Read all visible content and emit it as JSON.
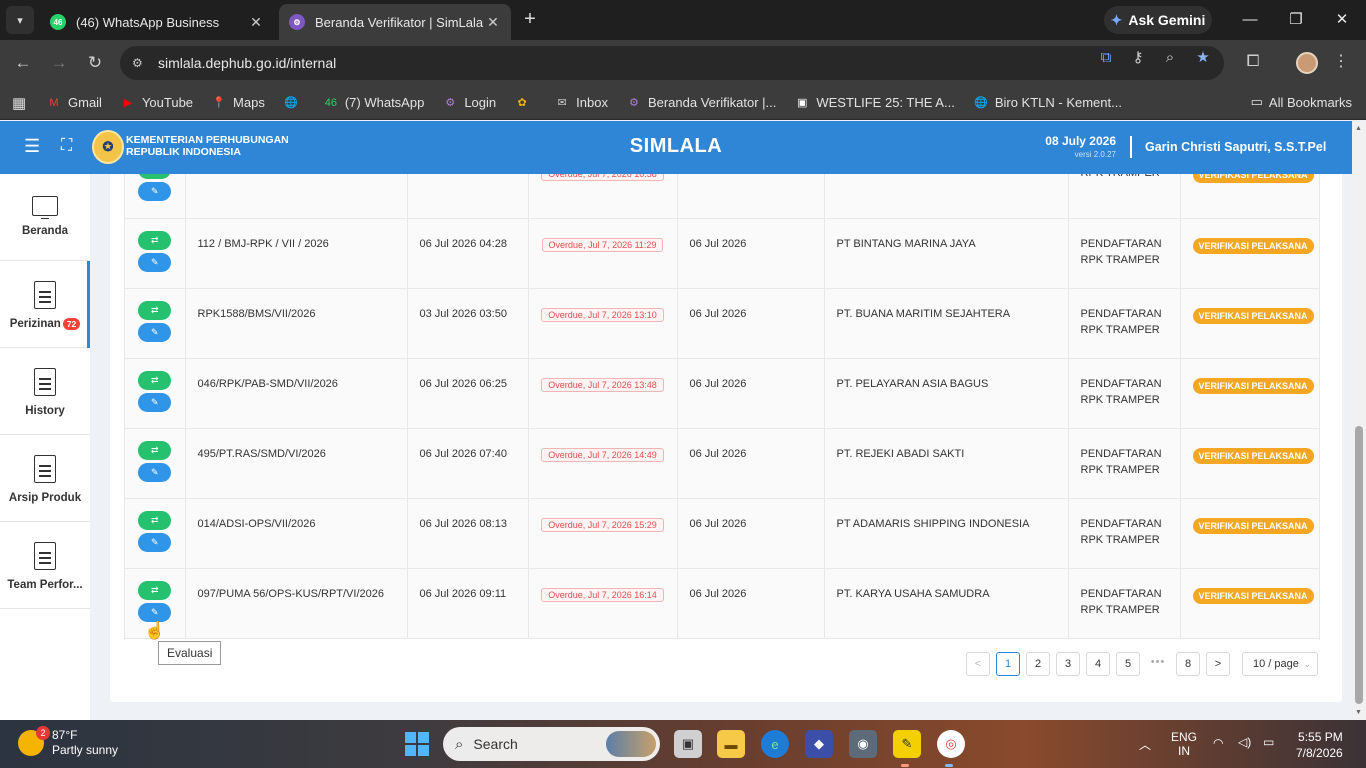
{
  "browser": {
    "tabs": [
      {
        "title": "(46) WhatsApp Business",
        "favicon": "46",
        "active": false
      },
      {
        "title": "Beranda Verifikator | SimLala",
        "favicon": "globe",
        "active": true
      }
    ],
    "gemini_label": "Ask Gemini",
    "url": "simlala.dephub.go.id/internal",
    "bookmarks": [
      {
        "label": "Gmail",
        "icon": "M",
        "color": "#ea4335"
      },
      {
        "label": "YouTube",
        "icon": "▶",
        "color": "#ff0000"
      },
      {
        "label": "Maps",
        "icon": "📍",
        "color": "#34a853"
      },
      {
        "label": "",
        "icon": "🌐",
        "color": "#cccccc"
      },
      {
        "label": "(7) WhatsApp",
        "icon": "46",
        "color": "#25d366"
      },
      {
        "label": "Login",
        "icon": "⚙",
        "color": "#b07dd8"
      },
      {
        "label": "",
        "icon": "✿",
        "color": "#f4b400"
      },
      {
        "label": "Inbox",
        "icon": "✉",
        "color": "#cccccc"
      },
      {
        "label": "Beranda Verifikator |...",
        "icon": "⚙",
        "color": "#b07dd8"
      },
      {
        "label": "WESTLIFE 25: THE A...",
        "icon": "▣",
        "color": "#ffffff"
      },
      {
        "label": "Biro KTLN - Kement...",
        "icon": "🌐",
        "color": "#cccccc"
      }
    ],
    "all_bookmarks": "All Bookmarks"
  },
  "header": {
    "ministry_line1": "KEMENTERIAN PERHUBUNGAN",
    "ministry_line2": "REPUBLIK INDONESIA",
    "app_title": "SIMLALA",
    "date": "08 July 2026",
    "version": "versi 2.0.27",
    "user": "Garin Christi Saputri, S.S.T.Pel"
  },
  "sidebar": {
    "items": [
      {
        "label": "Beranda",
        "icon": "monitor-icon"
      },
      {
        "label": "Perizinan",
        "icon": "document-icon",
        "badge": "72",
        "active": true
      },
      {
        "label": "History",
        "icon": "document-icon"
      },
      {
        "label": "Arsip Produk",
        "icon": "document-icon"
      },
      {
        "label": "Team Perfor...",
        "icon": "document-icon"
      }
    ]
  },
  "table": {
    "rows": [
      {
        "nomor": "",
        "tanggal": "",
        "due": "Overdue, Jul 7, 2026 10:58",
        "tgl": "",
        "perusahaan": "",
        "layanan": [
          "",
          "RPK TRAMPER"
        ],
        "status": "VERIFIKASI PELAKSANA"
      },
      {
        "nomor": "112 / BMJ-RPK / VII / 2026",
        "tanggal": "06 Jul 2026 04:28",
        "due": "Overdue, Jul 7, 2026 11:29",
        "tgl": "06 Jul 2026",
        "perusahaan": "PT BINTANG MARINA JAYA",
        "layanan": [
          "PENDAFTARAN",
          "RPK TRAMPER"
        ],
        "status": "VERIFIKASI PELAKSANA"
      },
      {
        "nomor": "RPK1588/BMS/VII/2026",
        "tanggal": "03 Jul 2026 03:50",
        "due": "Overdue, Jul 7, 2026 13:10",
        "tgl": "06 Jul 2026",
        "perusahaan": "PT. BUANA MARITIM SEJAHTERA",
        "layanan": [
          "PENDAFTARAN",
          "RPK TRAMPER"
        ],
        "status": "VERIFIKASI PELAKSANA"
      },
      {
        "nomor": "046/RPK/PAB-SMD/VII/2026",
        "tanggal": "06 Jul 2026 06:25",
        "due": "Overdue, Jul 7, 2026 13:48",
        "tgl": "06 Jul 2026",
        "perusahaan": "PT. PELAYARAN ASIA BAGUS",
        "layanan": [
          "PENDAFTARAN",
          "RPK TRAMPER"
        ],
        "status": "VERIFIKASI PELAKSANA"
      },
      {
        "nomor": "495/PT.RAS/SMD/VI/2026",
        "tanggal": "06 Jul 2026 07:40",
        "due": "Overdue, Jul 7, 2026 14:49",
        "tgl": "06 Jul 2026",
        "perusahaan": "PT. REJEKI ABADI SAKTI",
        "layanan": [
          "PENDAFTARAN",
          "RPK TRAMPER"
        ],
        "status": "VERIFIKASI PELAKSANA"
      },
      {
        "nomor": "014/ADSI-OPS/VII/2026",
        "tanggal": "06 Jul 2026 08:13",
        "due": "Overdue, Jul 7, 2026 15:29",
        "tgl": "06 Jul 2026",
        "perusahaan": "PT ADAMARIS SHIPPING INDONESIA",
        "layanan": [
          "PENDAFTARAN",
          "RPK TRAMPER"
        ],
        "status": "VERIFIKASI PELAKSANA"
      },
      {
        "nomor": "097/PUMA 56/OPS-KUS/RPT/VI/2026",
        "tanggal": "06 Jul 2026 09:11",
        "due": "Overdue, Jul 7, 2026 16:14",
        "tgl": "06 Jul 2026",
        "perusahaan": "PT. KARYA USAHA SAMUDRA",
        "layanan": [
          "PENDAFTARAN",
          "RPK TRAMPER"
        ],
        "status": "VERIFIKASI PELAKSANA"
      }
    ]
  },
  "pagination": {
    "prev": "<",
    "pages": [
      "1",
      "2",
      "3",
      "4",
      "5"
    ],
    "ellipsis": "•••",
    "last": "8",
    "next": ">",
    "current": "1",
    "page_size": "10 / page"
  },
  "tooltip": "Evaluasi",
  "taskbar": {
    "weather_temp": "87°F",
    "weather_desc": "Partly sunny",
    "weather_badge": "2",
    "search_placeholder": "Search",
    "lang1": "ENG",
    "lang2": "IN",
    "time": "5:55 PM",
    "date": "7/8/2026"
  },
  "colors": {
    "header_blue": "#2f86d6",
    "action_green": "#25c16f",
    "action_blue": "#2f95e8",
    "status_orange": "#f5a623",
    "overdue_red": "#e74c4c"
  }
}
